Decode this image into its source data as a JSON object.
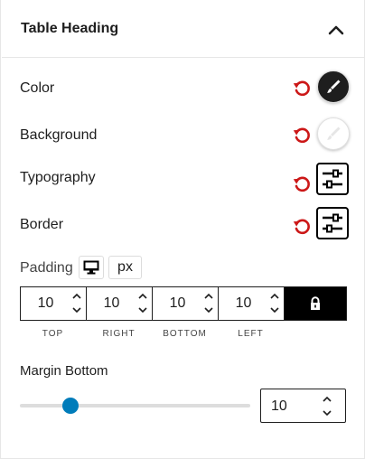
{
  "panel": {
    "title": "Table Heading",
    "collapse_icon": "chevron-up-icon"
  },
  "rows": {
    "color": {
      "label": "Color",
      "swatch_color": "#1e1e1e",
      "icon": "brush-icon"
    },
    "background": {
      "label": "Background",
      "swatch_color": "#ffffff",
      "icon": "brush-icon"
    },
    "typography": {
      "label": "Typography",
      "icon": "sliders-icon"
    },
    "border": {
      "label": "Border",
      "icon": "sliders-icon"
    }
  },
  "reset_color": "#cc1818",
  "padding": {
    "label": "Padding",
    "device_icon": "desktop-icon",
    "unit": "px",
    "values": {
      "top": "10",
      "right": "10",
      "bottom": "10",
      "left": "10"
    },
    "labels": {
      "top": "TOP",
      "right": "RIGHT",
      "bottom": "BOTTOM",
      "left": "LEFT"
    },
    "lock_icon": "lock-icon"
  },
  "margin_bottom": {
    "label": "Margin Bottom",
    "value": "10",
    "slider_fraction": 0.22
  },
  "accent": "#007cba"
}
